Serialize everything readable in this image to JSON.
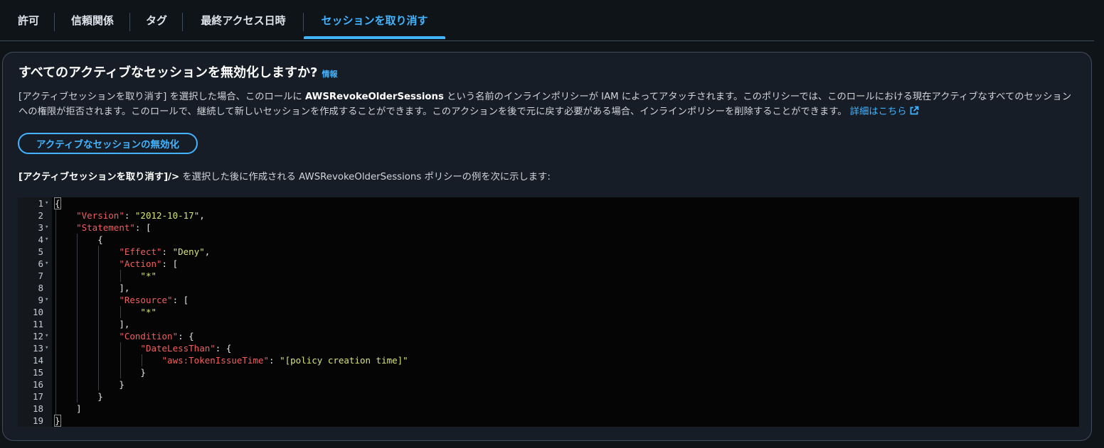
{
  "tabs": [
    {
      "label": "許可",
      "active": false
    },
    {
      "label": "信頼関係",
      "active": false
    },
    {
      "label": "タグ",
      "active": false
    },
    {
      "label": "最終アクセス日時",
      "active": false
    },
    {
      "label": "セッションを取り消す",
      "active": true
    }
  ],
  "panel": {
    "heading": "すべてのアクティブなセッションを無効化しますか?",
    "info_link": "情報",
    "description": {
      "part1": "[アクティブセッションを取り消す] を選択した場合、このロールに ",
      "policy_name": "AWSRevokeOlderSessions",
      "part2": " という名前のインラインポリシーが IAM によってアタッチされます。このポリシーでは、このロールにおける現在アクティブなすべてのセッションへの権限が拒否されます。このロールで、継続して新しいセッションを作成することができます。このアクションを後で元に戻す必要がある場合、インラインポリシーを削除することができます。",
      "learn_more": "詳細はこちら",
      "external_icon": "external-link-icon"
    },
    "revoke_button": "アクティブなセッションの無効化",
    "example": {
      "bold": "[アクティブセッションを取り消す]/>",
      "rest": " を選択した後に作成される AWSRevokeOlderSessions ポリシーの例を次に示します:"
    }
  },
  "code": {
    "fold_icon": "fold-arrow-icon",
    "lines": [
      {
        "n": "1",
        "fold": true,
        "indent": 0,
        "tokens": [
          {
            "t": "{",
            "c": "p"
          }
        ]
      },
      {
        "n": "2",
        "fold": false,
        "indent": 1,
        "tokens": [
          {
            "t": "\"Version\"",
            "c": "k"
          },
          {
            "t": ": ",
            "c": "p"
          },
          {
            "t": "\"2012-10-17\"",
            "c": "s"
          },
          {
            "t": ",",
            "c": "p"
          }
        ]
      },
      {
        "n": "3",
        "fold": true,
        "indent": 1,
        "tokens": [
          {
            "t": "\"Statement\"",
            "c": "k"
          },
          {
            "t": ": [",
            "c": "p"
          }
        ]
      },
      {
        "n": "4",
        "fold": true,
        "indent": 2,
        "tokens": [
          {
            "t": "{",
            "c": "p"
          }
        ]
      },
      {
        "n": "5",
        "fold": false,
        "indent": 3,
        "tokens": [
          {
            "t": "\"Effect\"",
            "c": "k"
          },
          {
            "t": ": ",
            "c": "p"
          },
          {
            "t": "\"Deny\"",
            "c": "s"
          },
          {
            "t": ",",
            "c": "p"
          }
        ]
      },
      {
        "n": "6",
        "fold": true,
        "indent": 3,
        "tokens": [
          {
            "t": "\"Action\"",
            "c": "k"
          },
          {
            "t": ": [",
            "c": "p"
          }
        ]
      },
      {
        "n": "7",
        "fold": false,
        "indent": 4,
        "tokens": [
          {
            "t": "\"*\"",
            "c": "s"
          }
        ]
      },
      {
        "n": "8",
        "fold": false,
        "indent": 3,
        "tokens": [
          {
            "t": "],",
            "c": "p"
          }
        ]
      },
      {
        "n": "9",
        "fold": true,
        "indent": 3,
        "tokens": [
          {
            "t": "\"Resource\"",
            "c": "k"
          },
          {
            "t": ": [",
            "c": "p"
          }
        ]
      },
      {
        "n": "10",
        "fold": false,
        "indent": 4,
        "tokens": [
          {
            "t": "\"*\"",
            "c": "s"
          }
        ]
      },
      {
        "n": "11",
        "fold": false,
        "indent": 3,
        "tokens": [
          {
            "t": "],",
            "c": "p"
          }
        ]
      },
      {
        "n": "12",
        "fold": true,
        "indent": 3,
        "tokens": [
          {
            "t": "\"Condition\"",
            "c": "k"
          },
          {
            "t": ": {",
            "c": "p"
          }
        ]
      },
      {
        "n": "13",
        "fold": true,
        "indent": 4,
        "tokens": [
          {
            "t": "\"DateLessThan\"",
            "c": "k"
          },
          {
            "t": ": {",
            "c": "p"
          }
        ]
      },
      {
        "n": "14",
        "fold": false,
        "indent": 5,
        "tokens": [
          {
            "t": "\"aws:TokenIssueTime\"",
            "c": "k"
          },
          {
            "t": ": ",
            "c": "p"
          },
          {
            "t": "\"[policy creation time]\"",
            "c": "s"
          }
        ]
      },
      {
        "n": "15",
        "fold": false,
        "indent": 4,
        "tokens": [
          {
            "t": "}",
            "c": "p"
          }
        ]
      },
      {
        "n": "16",
        "fold": false,
        "indent": 3,
        "tokens": [
          {
            "t": "}",
            "c": "p"
          }
        ]
      },
      {
        "n": "17",
        "fold": false,
        "indent": 2,
        "tokens": [
          {
            "t": "}",
            "c": "p"
          }
        ]
      },
      {
        "n": "18",
        "fold": false,
        "indent": 1,
        "tokens": [
          {
            "t": "]",
            "c": "p"
          }
        ]
      },
      {
        "n": "19",
        "fold": false,
        "indent": 0,
        "tokens": [
          {
            "t": "}",
            "c": "p"
          }
        ]
      }
    ]
  }
}
